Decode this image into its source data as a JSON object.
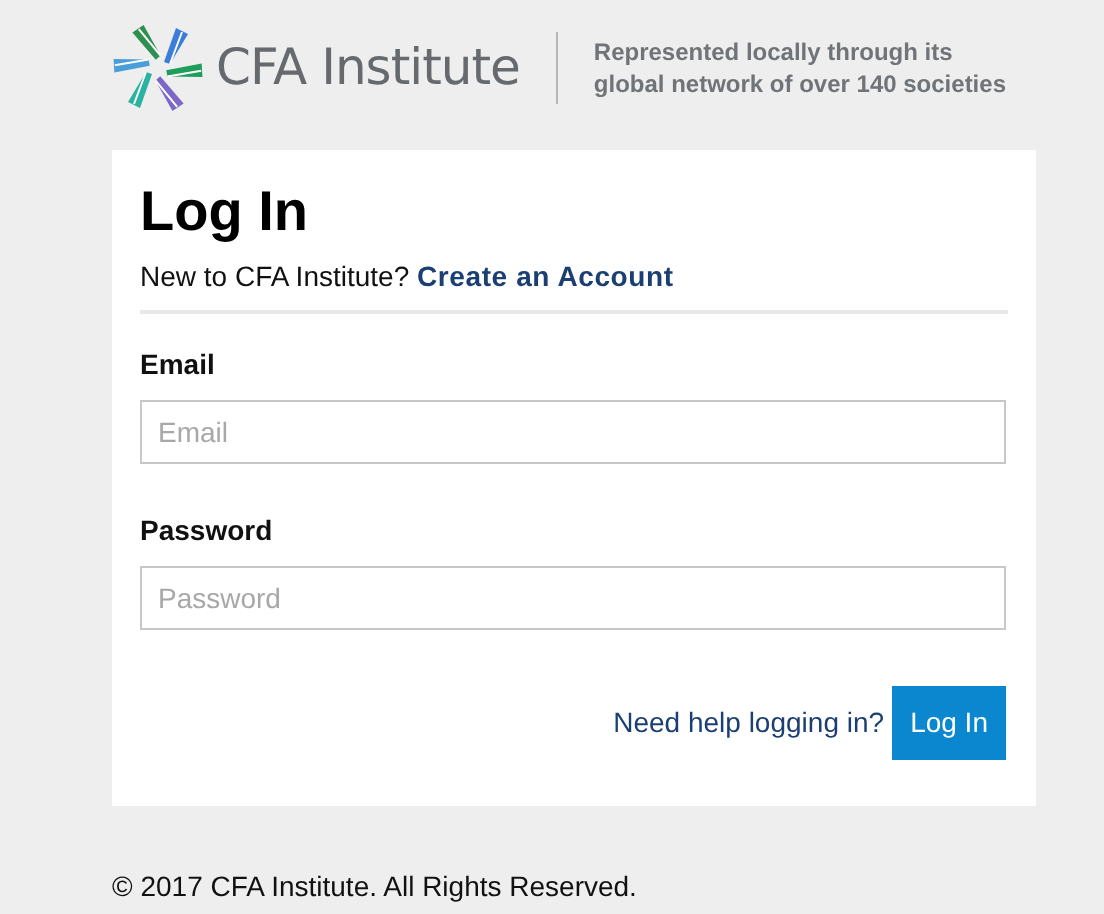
{
  "header": {
    "brand": "CFA Institute",
    "tagline_lines": [
      "Represented locally through its",
      "global network of over 140 societies"
    ]
  },
  "login": {
    "title": "Log In",
    "prompt": "New to CFA Institute?",
    "create_link": "Create an Account",
    "fields": [
      {
        "label": "Email",
        "placeholder": "Email"
      },
      {
        "label": "Password",
        "placeholder": "Password"
      }
    ],
    "help_link": "Need help logging in?",
    "submit": "Log In"
  },
  "footer": {
    "copyright": "© 2017 CFA Institute. All Rights Reserved."
  }
}
